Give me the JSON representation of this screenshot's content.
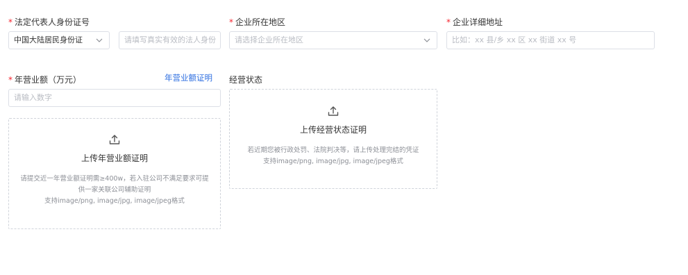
{
  "legal_id": {
    "label": "法定代表人身份证号",
    "id_type_value": "中国大陆居民身份证",
    "id_number_placeholder": "请填写真实有效的法人身份"
  },
  "company_region": {
    "label": "企业所在地区",
    "placeholder": "请选择企业所在地区"
  },
  "company_address": {
    "label": "企业详细地址",
    "placeholder": "比如：xx 县/乡 xx 区 xx 街道 xx 号"
  },
  "annual_revenue": {
    "label": "年营业额（万元）",
    "proof_link": "年营业额证明",
    "placeholder": "请输入数字",
    "upload_title": "上传年营业额证明",
    "upload_hint_line1": "请提交近一年营业额证明需≥400w，若入驻公司不满足要求可提",
    "upload_hint_line2": "供一家关联公司辅助证明",
    "upload_hint_line3": "支持image/png, image/jpg, image/jpeg格式"
  },
  "business_status": {
    "label": "经营状态",
    "upload_title": "上传经营状态证明",
    "upload_hint_line1": "若近期您被行政处罚、法院判决等，请上传处理完结的凭证",
    "upload_hint_line2": "支持image/png, image/jpg, image/jpeg格式"
  },
  "required_mark": "*",
  "icons": {
    "dropdown": "chevron-down-icon",
    "upload": "upload-icon"
  }
}
